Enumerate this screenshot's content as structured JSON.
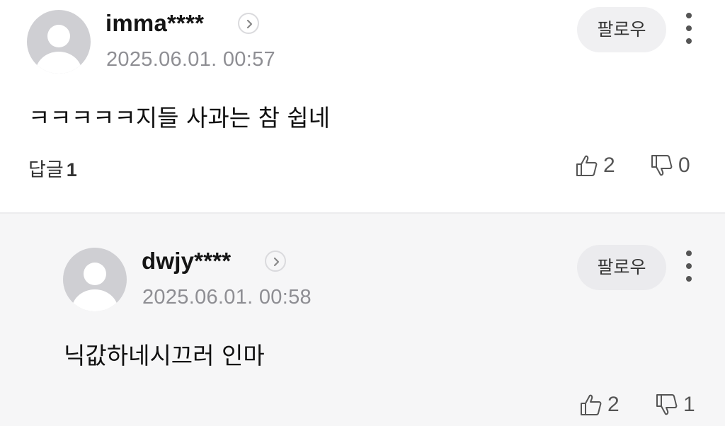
{
  "comments": [
    {
      "username": "imma****",
      "timestamp": "2025.06.01. 00:57",
      "text": "ㅋㅋㅋㅋㅋ지들 사과는 참 쉽네",
      "follow_label": "팔로우",
      "reply_label": "답글",
      "reply_count": "1",
      "likes": "2",
      "dislikes": "0"
    },
    {
      "username": "dwjy****",
      "timestamp": "2025.06.01. 00:58",
      "text": "닉값하네시끄러 인마",
      "follow_label": "팔로우",
      "likes": "2",
      "dislikes": "1"
    }
  ],
  "icons": {
    "profile_arrow": "chevron-right-icon",
    "more": "vertical-dots-icon",
    "like": "thumbs-up-icon",
    "dislike": "thumbs-down-icon",
    "avatar": "default-avatar-icon"
  },
  "colors": {
    "reply_background": "#f6f6f7",
    "timestamp": "#8e8e93",
    "avatar": "#cfcfd3"
  }
}
